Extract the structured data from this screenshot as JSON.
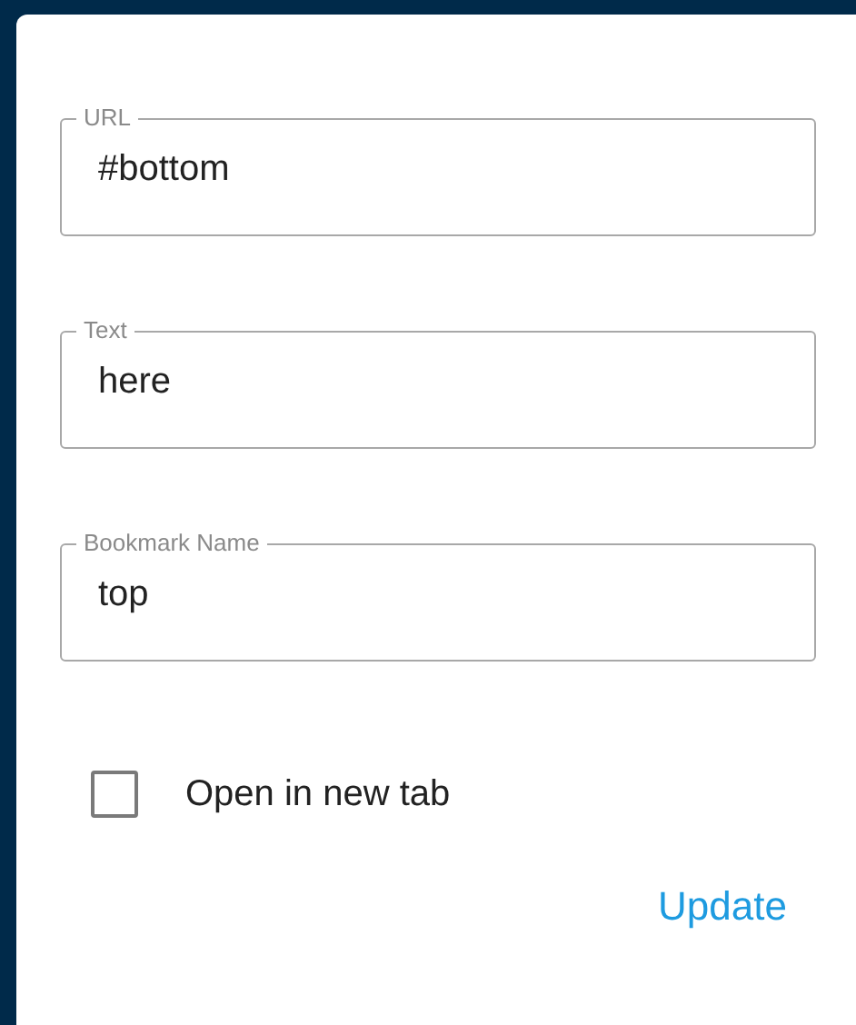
{
  "fields": [
    {
      "label": "URL",
      "value": "#bottom"
    },
    {
      "label": "Text",
      "value": "here"
    },
    {
      "label": "Bookmark Name",
      "value": "top"
    }
  ],
  "checkbox": {
    "label": "Open in new tab",
    "checked": false
  },
  "buttons": [
    "Update"
  ]
}
